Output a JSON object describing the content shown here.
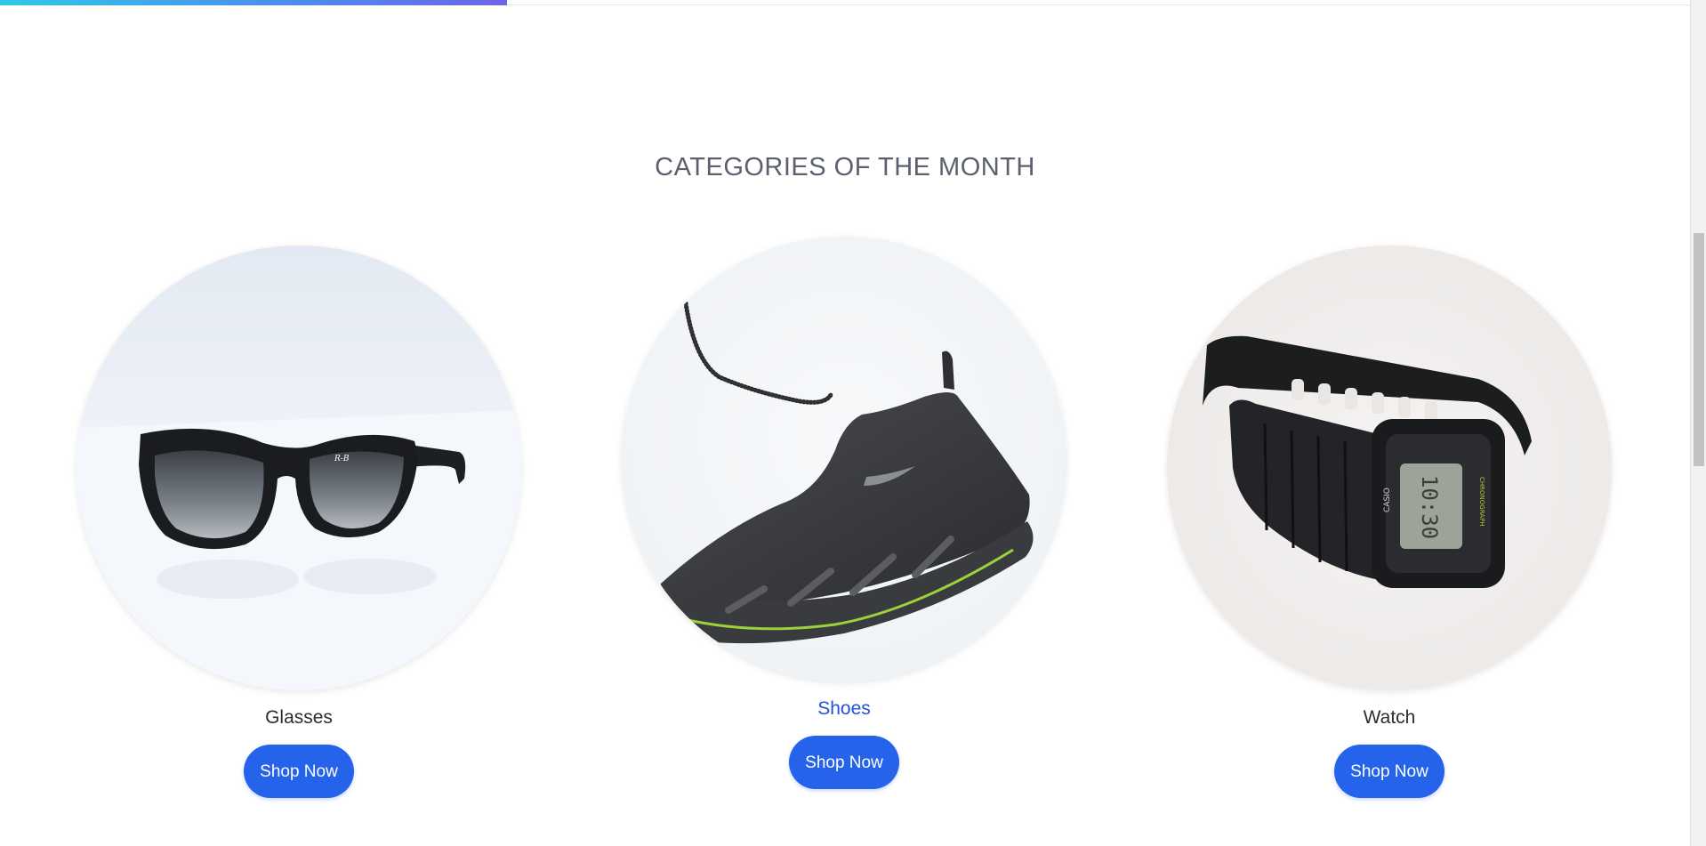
{
  "progress": {
    "fraction": 0.3,
    "colors": [
      "#2ec9e6",
      "#6e63ea"
    ]
  },
  "section": {
    "title": "CATEGORIES OF THE MONTH"
  },
  "categories": [
    {
      "name": "Glasses",
      "button_label": "Shop Now",
      "icon": "sunglasses-image"
    },
    {
      "name": "Shoes",
      "button_label": "Shop Now",
      "icon": "sneaker-image"
    },
    {
      "name": "Watch",
      "button_label": "Shop Now",
      "icon": "wristwatch-image"
    }
  ],
  "colors": {
    "accent": "#2563eb",
    "title": "#5b5f6e",
    "link_active": "#2451d6"
  }
}
